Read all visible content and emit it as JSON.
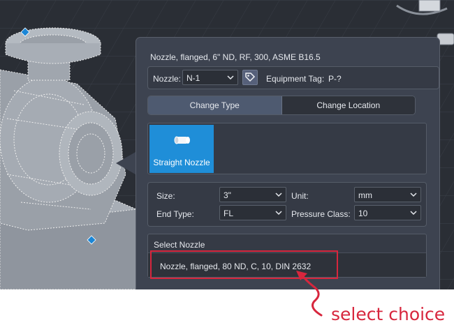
{
  "palette": {
    "title": "Nozzle, flanged, 6\" ND, RF, 300, ASME B16.5",
    "nozzle_label": "Nozzle:",
    "nozzle_value": "N-1",
    "equipment_tag_label": "Equipment Tag:",
    "equipment_tag_value": "P-?",
    "tabs": [
      {
        "label": "Change Type",
        "active": true
      },
      {
        "label": "Change Location",
        "active": false
      }
    ],
    "nozzle_types": [
      {
        "label": "Straight Nozzle",
        "selected": true,
        "icon": "straight-nozzle-icon"
      }
    ],
    "properties": {
      "size_label": "Size:",
      "size_value": "3\"",
      "unit_label": "Unit:",
      "unit_value": "mm",
      "end_type_label": "End Type:",
      "end_type_value": "FL",
      "pressure_class_label": "Pressure Class:",
      "pressure_class_value": "10"
    },
    "select_nozzle": {
      "heading": "Select Nozzle",
      "items": [
        "Nozzle, flanged, 80 ND, C, 10, DIN 2632"
      ]
    }
  },
  "annotation": {
    "text": "select choice",
    "color": "#d7263d"
  },
  "colors": {
    "accent": "#1f8ed8",
    "panel": "#3d4350",
    "viewport": "#2a2e35"
  }
}
